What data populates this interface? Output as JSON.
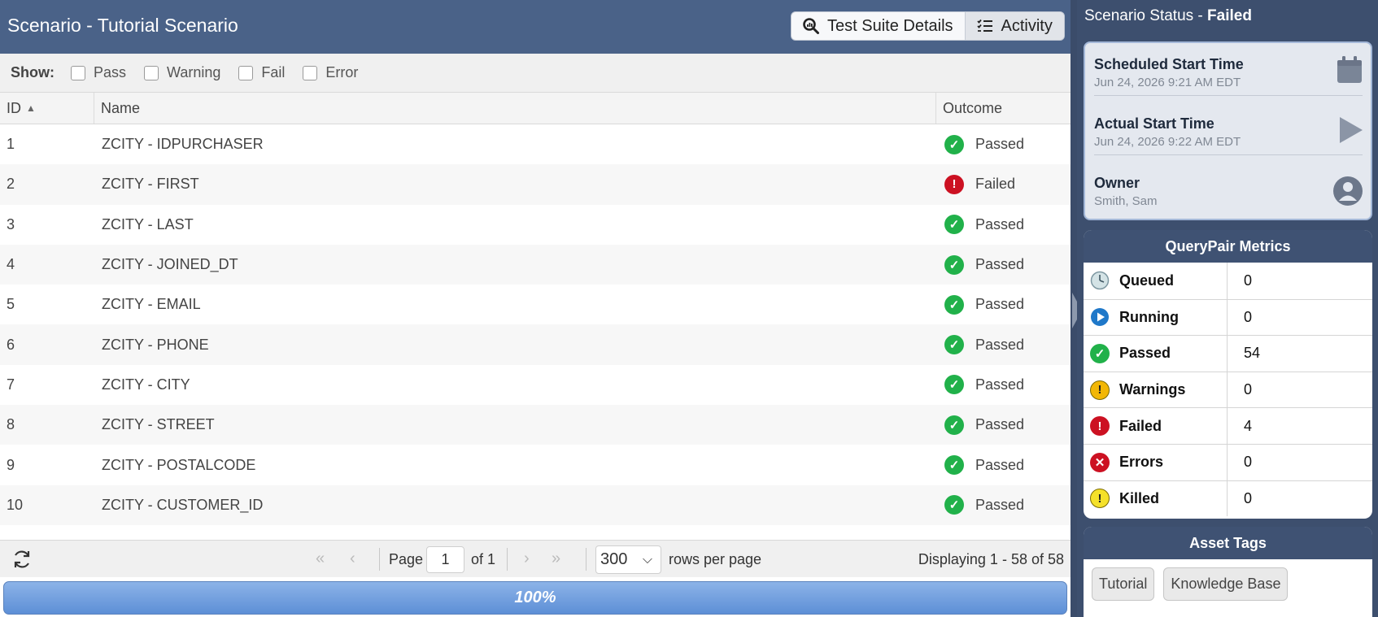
{
  "header": {
    "title": "Scenario - Tutorial Scenario",
    "tabs": [
      {
        "label": "Test Suite Details",
        "icon": "magnifier-chart-icon"
      },
      {
        "label": "Activity",
        "icon": "checklist-icon",
        "active": true
      }
    ]
  },
  "filters": {
    "label": "Show:",
    "options": [
      {
        "label": "Pass",
        "checked": false
      },
      {
        "label": "Warning",
        "checked": false
      },
      {
        "label": "Fail",
        "checked": false
      },
      {
        "label": "Error",
        "checked": false
      }
    ]
  },
  "table": {
    "columns": [
      "ID",
      "Name",
      "Outcome"
    ],
    "sort": {
      "column": "ID",
      "direction": "asc"
    },
    "rows": [
      {
        "id": "1",
        "name": "ZCITY - IDPURCHASER",
        "outcome": "Passed",
        "status": "ok"
      },
      {
        "id": "2",
        "name": "ZCITY - FIRST",
        "outcome": "Failed",
        "status": "bad"
      },
      {
        "id": "3",
        "name": "ZCITY - LAST",
        "outcome": "Passed",
        "status": "ok"
      },
      {
        "id": "4",
        "name": "ZCITY - JOINED_DT",
        "outcome": "Passed",
        "status": "ok"
      },
      {
        "id": "5",
        "name": "ZCITY - EMAIL",
        "outcome": "Passed",
        "status": "ok"
      },
      {
        "id": "6",
        "name": "ZCITY - PHONE",
        "outcome": "Passed",
        "status": "ok"
      },
      {
        "id": "7",
        "name": "ZCITY - CITY",
        "outcome": "Passed",
        "status": "ok"
      },
      {
        "id": "8",
        "name": "ZCITY - STREET",
        "outcome": "Passed",
        "status": "ok"
      },
      {
        "id": "9",
        "name": "ZCITY - POSTALCODE",
        "outcome": "Passed",
        "status": "ok"
      },
      {
        "id": "10",
        "name": "ZCITY - CUSTOMER_ID",
        "outcome": "Passed",
        "status": "ok"
      }
    ]
  },
  "pager": {
    "page_label": "Page",
    "page": "1",
    "of_label": "of 1",
    "rows_per_page": "300",
    "rows_label": "rows per page",
    "display_text": "Displaying 1 - 58 of 58"
  },
  "progress": {
    "label": "100%",
    "value": 1.0
  },
  "status": {
    "title_prefix": "Scenario Status - ",
    "status_value": "Failed",
    "scheduled_label": "Scheduled Start Time",
    "scheduled_value": "Jun 24, 2026 9:21 AM EDT",
    "actual_label": "Actual Start Time",
    "actual_value": "Jun 24, 2026 9:22 AM EDT",
    "owner_label": "Owner",
    "owner_value": "Smith, Sam"
  },
  "metrics": {
    "title": "QueryPair Metrics",
    "rows": [
      {
        "label": "Queued",
        "value": "0",
        "icon": "clock-icon"
      },
      {
        "label": "Running",
        "value": "0",
        "icon": "play-circle-icon"
      },
      {
        "label": "Passed",
        "value": "54",
        "icon": "check-circle-icon"
      },
      {
        "label": "Warnings",
        "value": "0",
        "icon": "warning-circle-icon"
      },
      {
        "label": "Failed",
        "value": "4",
        "icon": "failed-circle-icon"
      },
      {
        "label": "Errors",
        "value": "0",
        "icon": "error-x-icon"
      },
      {
        "label": "Killed",
        "value": "0",
        "icon": "killed-circle-icon"
      }
    ]
  },
  "asset_tags": {
    "title": "Asset Tags",
    "tags": [
      "Tutorial",
      "Knowledge Base"
    ]
  },
  "colors": {
    "header_bg": "#4a6288",
    "panel_bg": "#3d4f6e",
    "passed": "#21b14a",
    "failed": "#cc1122",
    "progress": "#6a98dc"
  }
}
